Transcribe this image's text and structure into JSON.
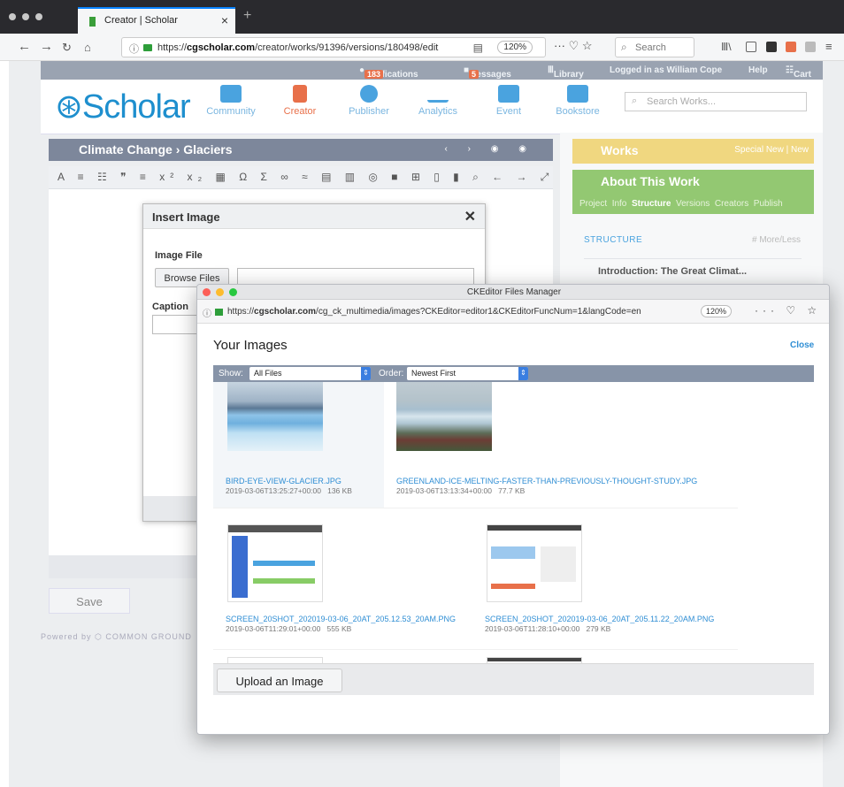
{
  "browser": {
    "tab_title": "Creator | Scholar",
    "url_prefix": "https://",
    "url_host": "cgscholar.com",
    "url_path": "/creator/works/91396/versions/180498/edit",
    "zoom": "120%",
    "search_placeholder": "Search"
  },
  "topbar": {
    "notifications": "Notifications",
    "notifications_count": "183",
    "messages": "Messages",
    "messages_count": "5",
    "library": "Library",
    "logged_in": "Logged in as William Cope",
    "help": "Help",
    "cart": "Cart"
  },
  "header": {
    "logo": "Scholar",
    "nav": [
      "Community",
      "Creator",
      "Publisher",
      "Analytics",
      "Event",
      "Bookstore"
    ],
    "search_placeholder": "Search Works..."
  },
  "editor": {
    "breadcrumb": "Climate Change › Glaciers",
    "toolbar_glyphs": "A ≡ ☷ ❞ ≡ x² x₂ ▦ Ω Σ ∞ ≈ ▤ ▥ ◎ ■ ⊞ ▯ ▮ ⌕ ← → ⤢",
    "save_label": "Save"
  },
  "footer": {
    "powered_by": "Powered by",
    "brand": "COMMON GROUND"
  },
  "right_panel": {
    "works_title": "Works",
    "works_actions": "Special New  |  New",
    "about_title": "About This Work",
    "tabs": [
      "Project",
      "Info",
      "Structure",
      "Versions",
      "Creators",
      "Publish"
    ],
    "active_tab": "Structure",
    "structure_label": "STRUCTURE",
    "more_less": "# More/Less",
    "first_item": "Introduction: The Great Climat..."
  },
  "insert_dialog": {
    "title": "Insert Image",
    "image_file_label": "Image File",
    "browse_label": "Browse Files",
    "caption_label": "Caption"
  },
  "files_manager": {
    "window_title": "CKEditor Files Manager",
    "url_prefix": "https://",
    "url_host": "cgscholar.com",
    "url_path": "/cg_ck_multimedia/images?CKEditor=editor1&CKEditorFuncNum=1&langCode=en",
    "zoom": "120%",
    "heading": "Your Images",
    "close_label": "Close",
    "show_label": "Show:",
    "show_value": "All Files",
    "order_label": "Order:",
    "order_value": "Newest First",
    "upload_label": "Upload an Image",
    "images": [
      {
        "name": "BIRD-EYE-VIEW-GLACIER.JPG",
        "date": "2019-03-06T13:25:27+00:00",
        "size": "136 KB"
      },
      {
        "name": "GREENLAND-ICE-MELTING-FASTER-THAN-PREVIOUSLY-THOUGHT-STUDY.JPG",
        "date": "2019-03-06T13:13:34+00:00",
        "size": "77.7 KB"
      },
      {
        "name": "SCREEN_20SHOT_202019-03-06_20AT_205.12.53_20AM.PNG",
        "date": "2019-03-06T11:29:01+00:00",
        "size": "555 KB"
      },
      {
        "name": "SCREEN_20SHOT_202019-03-06_20AT_205.11.22_20AM.PNG",
        "date": "2019-03-06T11:28:10+00:00",
        "size": "279 KB"
      }
    ]
  }
}
